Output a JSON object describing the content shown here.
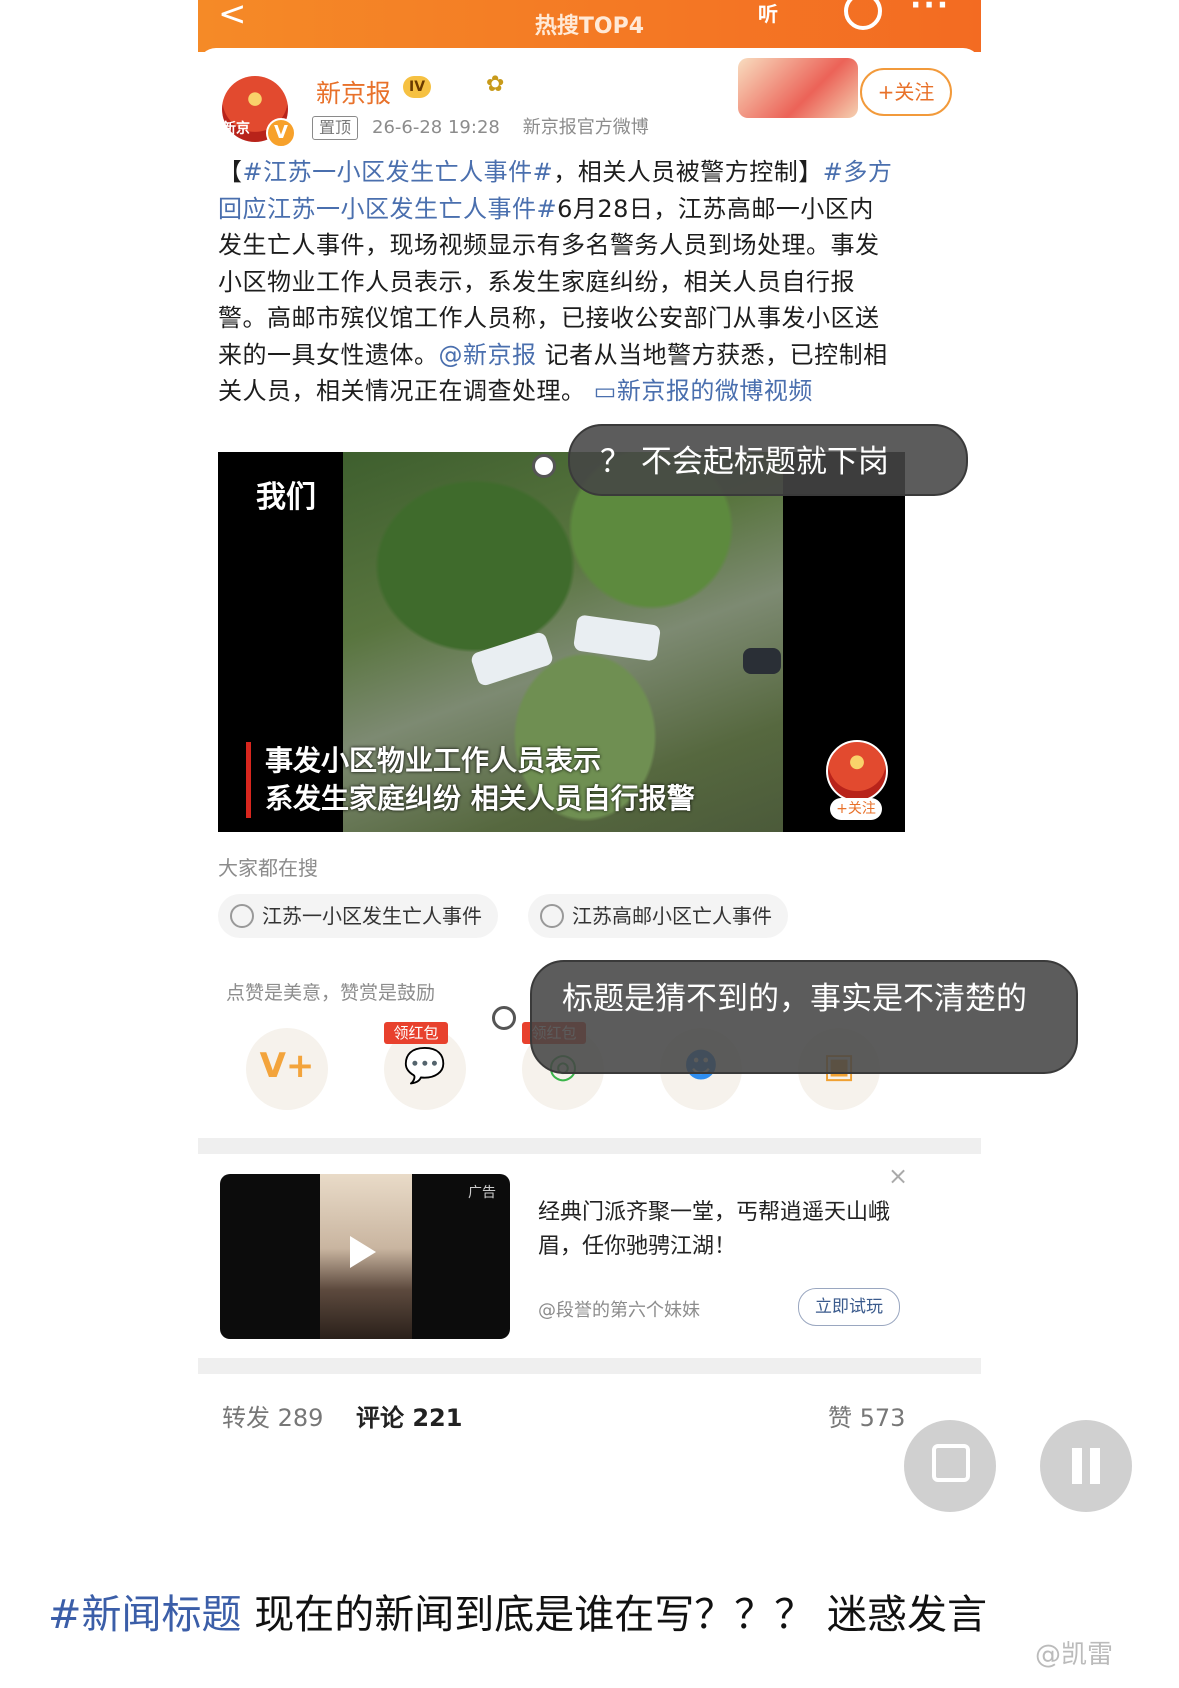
{
  "topbar": {
    "back": "<",
    "title": "热搜TOP4",
    "listen": "听",
    "more": "···"
  },
  "account": {
    "name": "新京报",
    "level_badge": "IV",
    "avatar_text": "新京",
    "pin_label": "置顶",
    "time": "26-6-28 19:28",
    "source": "新京报官方微博",
    "follow_label": "+关注"
  },
  "post": {
    "bracket_open": "【",
    "tag1": "#江苏一小区发生亡人事件#",
    "lead": "，相关人员被警方控制】",
    "tag2": "#多方回应江苏一小区发生亡人事件#",
    "body": "6月28日，江苏高邮一小区内发生亡人事件，现场视频显示有多名警务人员到场处理。事发小区物业工作人员表示，系发生家庭纠纷，相关人员自行报警。高邮市殡仪馆工作人员称，已接收公安部门从事发小区送来的一具女性遗体。",
    "mention": "@新京报",
    "tail": " 记者从当地警方获悉，已控制相关人员，相关情况正在调查处理。",
    "video_link": "新京报的微博视频"
  },
  "video": {
    "watermark": "我们",
    "caption_line1": "事发小区物业工作人员表示",
    "caption_line2": "系发生家庭纠纷 相关人员自行报警",
    "avatar_text": "新京报",
    "follow": "+关注"
  },
  "search": {
    "label": "大家都在搜",
    "chips": [
      "江苏一小区发生亡人事件",
      "江苏高邮小区亡人事件"
    ]
  },
  "reward_hint": "点赞是美意，赞赏是鼓励",
  "share": {
    "redpacket": "领红包",
    "icons": [
      "v-plus-icon",
      "wechat-icon",
      "moments-icon",
      "qq-icon",
      "save-image-icon"
    ]
  },
  "ad": {
    "tag": "广告",
    "text": "经典门派齐聚一堂，丐帮逍遥天山峨眉，任你驰骋江湖！",
    "author": "@段誉的第六个妹妹",
    "button": "立即试玩",
    "close": "×"
  },
  "stats": {
    "repost": "转发 289",
    "comment": "评论 221",
    "like": "赞 573"
  },
  "overlays": {
    "bubble1": "？ 不会起标题就下岗",
    "bubble2": "标题是猜不到的，事实是不清楚的"
  },
  "bottom": {
    "tag": "#新闻标题",
    "text": " 现在的新闻到底是谁在写？？？ 迷惑发言"
  },
  "watermark": "@凯雷"
}
